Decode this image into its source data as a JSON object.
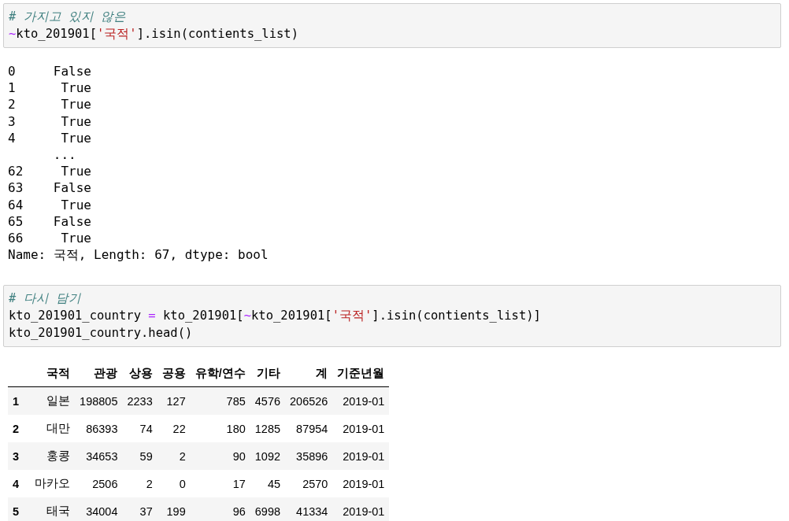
{
  "cells": [
    {
      "kind": "code",
      "lines": [
        [
          {
            "kind": "comment",
            "text": "# 가지고 있지 않은"
          }
        ],
        [
          {
            "kind": "op",
            "text": "~"
          },
          {
            "kind": "plain",
            "text": "kto_201901["
          },
          {
            "kind": "string",
            "text": "'국적'"
          },
          {
            "kind": "plain",
            "text": "].isin(contients_list)"
          }
        ]
      ]
    },
    {
      "kind": "output",
      "lines": [
        "0     False",
        "1      True",
        "2      True",
        "3      True",
        "4      True",
        "      ...",
        "62     True",
        "63    False",
        "64     True",
        "65    False",
        "66     True",
        "Name: 국적, Length: 67, dtype: bool"
      ]
    },
    {
      "kind": "code",
      "lines": [
        [
          {
            "kind": "comment",
            "text": "# 다시 담기"
          }
        ],
        [
          {
            "kind": "plain",
            "text": "kto_201901_country "
          },
          {
            "kind": "op",
            "text": "="
          },
          {
            "kind": "plain",
            "text": " kto_201901["
          },
          {
            "kind": "op",
            "text": "~"
          },
          {
            "kind": "plain",
            "text": "kto_201901["
          },
          {
            "kind": "string",
            "text": "'국적'"
          },
          {
            "kind": "plain",
            "text": "].isin(contients_list)]"
          }
        ],
        [
          {
            "kind": "plain",
            "text": "kto_201901_country.head()"
          }
        ]
      ]
    },
    {
      "kind": "table",
      "columns": [
        "국적",
        "관광",
        "상용",
        "공용",
        "유학/연수",
        "기타",
        "계",
        "기준년월"
      ],
      "rows": [
        {
          "index": "1",
          "cells": [
            "일본",
            "198805",
            "2233",
            "127",
            "785",
            "4576",
            "206526",
            "2019-01"
          ]
        },
        {
          "index": "2",
          "cells": [
            "대만",
            "86393",
            "74",
            "22",
            "180",
            "1285",
            "87954",
            "2019-01"
          ]
        },
        {
          "index": "3",
          "cells": [
            "홍콩",
            "34653",
            "59",
            "2",
            "90",
            "1092",
            "35896",
            "2019-01"
          ]
        },
        {
          "index": "4",
          "cells": [
            "마카오",
            "2506",
            "2",
            "0",
            "17",
            "45",
            "2570",
            "2019-01"
          ]
        },
        {
          "index": "5",
          "cells": [
            "태국",
            "34004",
            "37",
            "199",
            "96",
            "6998",
            "41334",
            "2019-01"
          ]
        }
      ]
    }
  ]
}
